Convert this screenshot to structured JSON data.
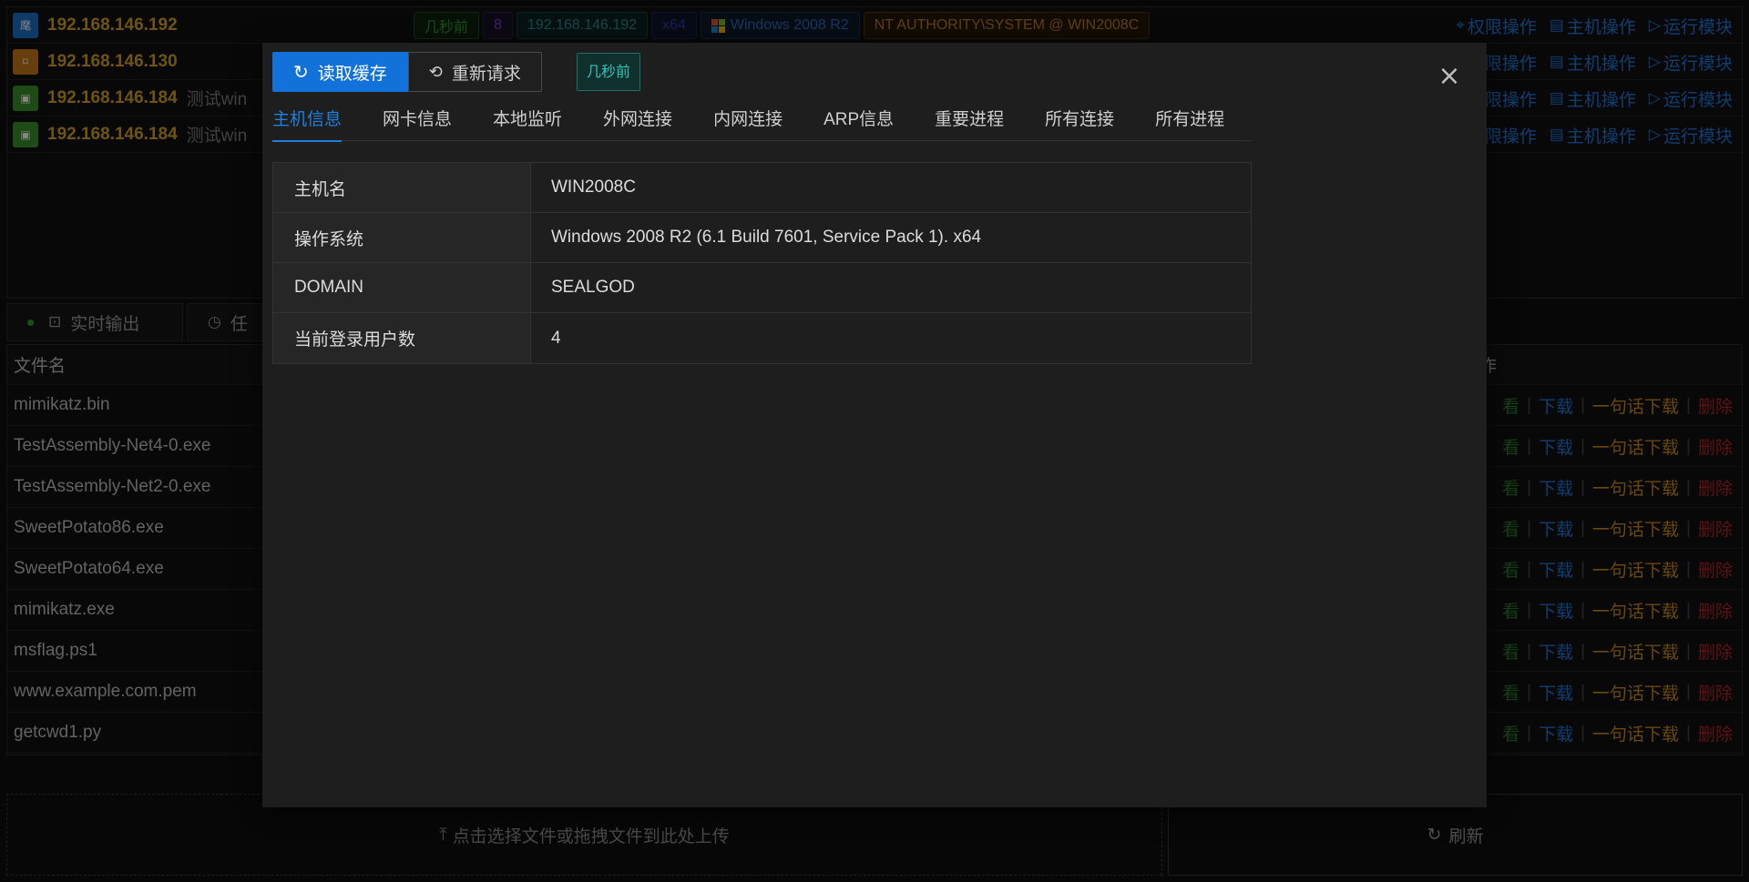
{
  "sessions": [
    {
      "ip": "192.168.146.192",
      "note": "",
      "icon": "tray-icon",
      "icon_color": "#1a6fc4",
      "icon_glyph": "麾",
      "tags": [
        {
          "label": "几秒前",
          "color": "#2f9a2f",
          "bg": "#0f220f",
          "border": "#1f4f1f"
        },
        {
          "label": "8",
          "color": "#7a3fc4",
          "bg": "#1a1228",
          "border": "#2e2247"
        },
        {
          "label": "192.168.146.192",
          "color": "#2a8f8f",
          "bg": "#0d2121",
          "border": "#1a4444"
        },
        {
          "label": "x64",
          "color": "#2c3fa8",
          "bg": "#101429",
          "border": "#1d2550"
        },
        {
          "label": "Windows 2008 R2",
          "color": "#2f68b8",
          "bg": "#0e1a2a",
          "border": "#1c3454"
        },
        {
          "label": "NT AUTHORITY\\SYSTEM @ WIN2008C",
          "color": "#b87a20",
          "bg": "#231807",
          "border": "#4a3210"
        }
      ]
    },
    {
      "ip": "192.168.146.130",
      "note": "",
      "icon": "frame-icon",
      "icon_color": "#c47a1a",
      "icon_glyph": "⌑"
    },
    {
      "ip": "192.168.146.184",
      "note": "测试win",
      "icon": "monitor-icon",
      "icon_color": "#3a8f2a",
      "icon_glyph": "▣"
    },
    {
      "ip": "192.168.146.184",
      "note": "测试win",
      "icon": "monitor-icon",
      "icon_color": "#3a8f2a",
      "icon_glyph": "▣"
    }
  ],
  "row_actions": {
    "perm": "权限操作",
    "perm_partial": "限操作",
    "host": "主机操作",
    "module": "运行模块"
  },
  "bottom_tabs": {
    "realtime": "实时输出",
    "task_partial": "任"
  },
  "files": {
    "header_name": "文件名",
    "header_right_partial": "作",
    "rows": [
      "mimikatz.bin",
      "TestAssembly-Net4-0.exe",
      "TestAssembly-Net2-0.exe",
      "SweetPotato86.exe",
      "SweetPotato64.exe",
      "mimikatz.exe",
      "msflag.ps1",
      "www.example.com.pem",
      "getcwd1.py"
    ],
    "ops": {
      "view_partial": "看",
      "download": "下载",
      "oneliner": "一句话下载",
      "delete": "删除"
    }
  },
  "upload_label": "点击选择文件或拖拽文件到此处上传",
  "refresh_label": "刷新",
  "modal": {
    "read_cache_label": "读取缓存",
    "re_request_label": "重新请求",
    "time_tag": "几秒前",
    "tabs": [
      "主机信息",
      "网卡信息",
      "本地监听",
      "外网连接",
      "内网连接",
      "ARP信息",
      "重要进程",
      "所有连接",
      "所有进程"
    ],
    "active_tab": 0,
    "info": [
      {
        "key": "主机名",
        "value": "WIN2008C"
      },
      {
        "key": "操作系统",
        "value": "Windows 2008 R2 (6.1 Build 7601, Service Pack 1). x64"
      },
      {
        "key": "DOMAIN",
        "value": "SEALGOD"
      },
      {
        "key": "当前登录用户数",
        "value": "4"
      }
    ]
  }
}
